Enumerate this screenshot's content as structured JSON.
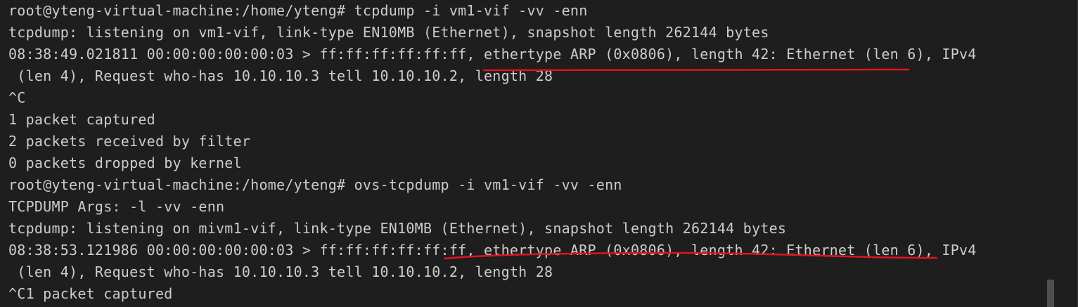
{
  "terminal": {
    "lines": [
      "root@yteng-virtual-machine:/home/yteng# tcpdump -i vm1-vif -vv -enn",
      "tcpdump: listening on vm1-vif, link-type EN10MB (Ethernet), snapshot length 262144 bytes",
      "08:38:49.021811 00:00:00:00:00:03 > ff:ff:ff:ff:ff:ff, ethertype ARP (0x0806), length 42: Ethernet (len 6), IPv4",
      " (len 4), Request who-has 10.10.10.3 tell 10.10.10.2, length 28",
      "^C",
      "1 packet captured",
      "2 packets received by filter",
      "0 packets dropped by kernel",
      "root@yteng-virtual-machine:/home/yteng# ovs-tcpdump -i vm1-vif -vv -enn",
      "TCPDUMP Args: -l -vv -enn",
      "tcpdump: listening on mivm1-vif, link-type EN10MB (Ethernet), snapshot length 262144 bytes",
      "08:38:53.121986 00:00:00:00:00:03 > ff:ff:ff:ff:ff:ff, ethertype ARP (0x0806), length 42: Ethernet (len 6), IPv4",
      " (len 4), Request who-has 10.10.10.3 tell 10.10.10.2, length 28",
      "^C1 packet captured"
    ]
  },
  "colors": {
    "background": "#1e1e1e",
    "text": "#cccccc",
    "annotation": "#e0141e",
    "scrollbar_thumb": "#4f4f4f"
  }
}
